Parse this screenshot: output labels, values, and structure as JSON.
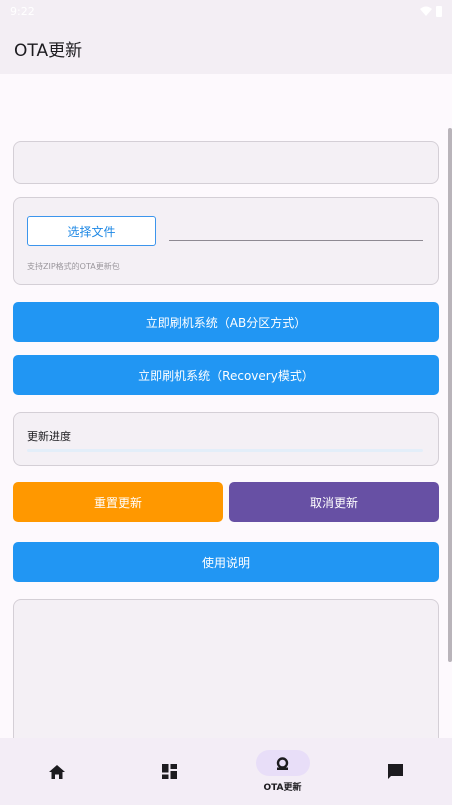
{
  "status_bar": {
    "time": "9:22"
  },
  "app_bar": {
    "title": "OTA更新"
  },
  "file_picker": {
    "button_label": "选择文件",
    "path_value": "",
    "hint": "支持ZIP格式的OTA更新包"
  },
  "actions": {
    "flash_ab_label": "立即刷机系统（AB分区方式）",
    "flash_recovery_label": "立即刷机系统（Recovery模式）",
    "reset_label": "重置更新",
    "cancel_label": "取消更新",
    "help_label": "使用说明"
  },
  "progress": {
    "label": "更新进度",
    "value": 0
  },
  "bottom_nav": {
    "items": [
      {
        "icon": "home-icon",
        "label": ""
      },
      {
        "icon": "dashboard-icon",
        "label": ""
      },
      {
        "icon": "ota-icon",
        "label": "OTA更新",
        "active": true
      },
      {
        "icon": "message-icon",
        "label": ""
      }
    ]
  },
  "colors": {
    "primary": "#2196f3",
    "reset": "#ff9800",
    "cancel": "#6750a4",
    "nav_active_pill": "#e8def8"
  }
}
